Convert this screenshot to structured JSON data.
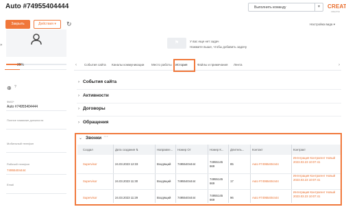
{
  "header": {
    "title": "Auto #74955404444",
    "command_placeholder": "Выполнить команду",
    "logo": "CREATIO",
    "logo_sub": "CREATIO",
    "close_label": "Закрыть",
    "actions_label": "Действия",
    "view_settings_label": "Настройка вида"
  },
  "profile": {
    "progress_fraction": 0.25,
    "progress_text": "25%",
    "globe_q": "?",
    "fields": [
      {
        "label": "ФИО*",
        "value": "Auto #74955404444"
      },
      {
        "label": "Полное название должности",
        "value": ""
      },
      {
        "label": "Мобильный телефон",
        "value": ""
      },
      {
        "label": "Рабочий телефон",
        "value": "74955404444"
      },
      {
        "label": "Email",
        "value": ""
      }
    ]
  },
  "notes": {
    "line1": "У вас еще нет задач",
    "line2": "Нажмите  выше, чтобы добавить задачу"
  },
  "tabs": [
    "События сайта",
    "Каналы коммуникации",
    "Место работы",
    "История",
    "Файлы и примечания",
    "Лента"
  ],
  "sections": [
    "События сайта",
    "Активности",
    "Договоры",
    "Обращения"
  ],
  "calls": {
    "title": "Звонки",
    "columns": [
      "Создал",
      "Дата создания",
      "Направле...",
      "Номер От",
      "Номер К...",
      "Длитель...",
      "Контакт",
      "Контракт"
    ],
    "rows": [
      {
        "created_by": "Supervisor",
        "date": "24.03.2023 12:33",
        "direction": "Входящий",
        "from": "74955404444",
        "to": "74955145 669",
        "duration": "85",
        "contact": "Auto #74955404444",
        "contract": "Интеграция Контрагент Новый 2023.03.23 10:07:41"
      },
      {
        "created_by": "Supervisor",
        "date": "24.03.2023 11:30",
        "direction": "Входящий",
        "from": "74955404444",
        "to": "74955145 669",
        "duration": "17",
        "contact": "Auto #74955404444",
        "contract": "Интеграция Контрагент Новый 2023.03.23 10:07:41"
      },
      {
        "created_by": "Supervisor",
        "date": "24.03.2023 11:29",
        "direction": "Входящий",
        "from": "74955404444",
        "to": "74955145 669",
        "duration": "96",
        "contact": "Auto #74955404444",
        "contract": "Интеграция Контрагент Новый 2023.03.23 10:07:41"
      }
    ]
  },
  "colors": {
    "accent": "#f0773a",
    "link": "#e96c2a"
  }
}
